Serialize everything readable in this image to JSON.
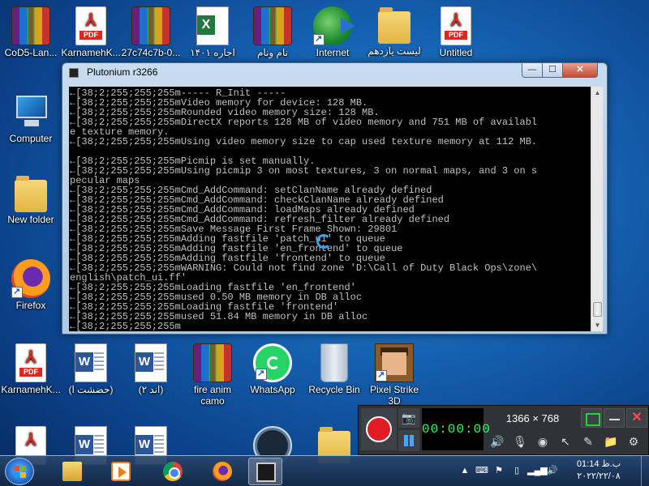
{
  "desktop": {
    "icons": [
      {
        "label": "CoD5-Lan...",
        "icon": "winrar-icon"
      },
      {
        "label": "KarnamehK...",
        "icon": "pdf-icon"
      },
      {
        "label": "27c74c7b-0...",
        "icon": "winrar-icon"
      },
      {
        "label": "اجاره ۱۴۰۱",
        "icon": "excel-icon"
      },
      {
        "label": "نام ونام",
        "icon": "winrar-icon"
      },
      {
        "label": "Internet",
        "icon": "internet-download-icon"
      },
      {
        "label": "لیست یازدهم",
        "icon": "folder-icon"
      },
      {
        "label": "Untitled",
        "icon": "pdf-icon"
      },
      {
        "label": "Computer",
        "icon": "computer-icon"
      },
      {
        "label": "New folder",
        "icon": "folder-icon"
      },
      {
        "label": "Firefox",
        "icon": "firefox-icon"
      },
      {
        "label": "KarnamehK...",
        "icon": "pdf-icon"
      },
      {
        "label": "(حضشت ا)",
        "icon": "word-icon"
      },
      {
        "label": "(اند ۲)",
        "icon": "word-icon"
      },
      {
        "label": "fire anim camo",
        "icon": "winrar-icon"
      },
      {
        "label": "WhatsApp",
        "icon": "whatsapp-icon"
      },
      {
        "label": "Recycle Bin",
        "icon": "recycle-bin-icon"
      },
      {
        "label": "Pixel Strike 3D",
        "icon": "game-icon"
      }
    ],
    "glyphs": {
      "pdf_symbol": "⅄",
      "pdf_tag": "PDF",
      "excel_letter": "X",
      "word_letter": "W"
    }
  },
  "console_window": {
    "title": "Plutonium r3266",
    "buttons": {
      "minimize": "—",
      "maximize": "☐",
      "close": "✕"
    },
    "lines": [
      "←[38;2;255;255;255m----- R_Init -----",
      "←[38;2;255;255;255mVideo memory for device: 128 MB.",
      "←[38;2;255;255;255mRounded video memory size: 128 MB.",
      "←[38;2;255;255;255mDirectX reports 128 MB of video memory and 751 MB of availabl",
      "e texture memory.",
      "←[38;2;255;255;255mUsing video memory size to cap used texture memory at 112 MB.",
      "",
      "←[38;2;255;255;255mPicmip is set manually.",
      "←[38;2;255;255;255mUsing picmip 3 on most textures, 3 on normal maps, and 3 on s",
      "pecular maps",
      "←[38;2;255;255;255mCmd_AddCommand: setClanName already defined",
      "←[38;2;255;255;255mCmd_AddCommand: checkClanName already defined",
      "←[38;2;255;255;255mCmd_AddCommand: loadMaps already defined",
      "←[38;2;255;255;255mCmd_AddCommand: refresh_filter already defined",
      "←[38;2;255;255;255mSave Message First Frame Shown: 29801",
      "←[38;2;255;255;255mAdding fastfile 'patch_ui' to queue",
      "←[38;2;255;255;255mAdding fastfile 'en_frontend' to queue",
      "←[38;2;255;255;255mAdding fastfile 'frontend' to queue",
      "←[38;2;255;255;255mWARNING: Could not find zone 'D:\\Call of Duty Black Ops\\zone\\",
      "english\\patch_ui.ff'",
      "←[38;2;255;255;255mLoading fastfile 'en_frontend'",
      "←[38;2;255;255;255mused 0.50 MB memory in DB alloc",
      "←[38;2;255;255;255mLoading fastfile 'frontend'",
      "←[38;2;255;255;255mused 51.84 MB memory in DB alloc",
      "←[38;2;255;255;255m"
    ],
    "scroll_arrows": {
      "up": "▲",
      "down": "▼"
    }
  },
  "recorder": {
    "timer": "00:00:00",
    "resolution": "1366 × 768",
    "camera_glyph": "📷",
    "close_glyph": "✕",
    "tools": [
      {
        "name": "speaker-icon",
        "glyph": "🔊"
      },
      {
        "name": "microphone-icon",
        "glyph": "🎙"
      },
      {
        "name": "webcam-icon",
        "glyph": "◉"
      },
      {
        "name": "pointer-icon",
        "glyph": "↖"
      },
      {
        "name": "pen-icon",
        "glyph": "✎"
      },
      {
        "name": "folder-icon",
        "glyph": "📁"
      },
      {
        "name": "settings-icon",
        "glyph": "⚙"
      }
    ]
  },
  "taskbar": {
    "apps": [
      {
        "name": "explorer"
      },
      {
        "name": "media-player"
      },
      {
        "name": "chrome"
      },
      {
        "name": "firefox"
      },
      {
        "name": "plutonium-console",
        "active": true
      }
    ],
    "tray_glyphs": [
      "▲",
      "⌨",
      "⚑",
      "▯",
      "▂▄▆",
      "🔊"
    ],
    "clock_time": "ب.ظ 01:14",
    "clock_date": "۲۰۲۲/۲۲/۰۸"
  },
  "colors": {
    "console_bg": "#000000",
    "console_text": "#c0c0c0",
    "record": "#e31b23",
    "timer_text": "#29ff66"
  }
}
